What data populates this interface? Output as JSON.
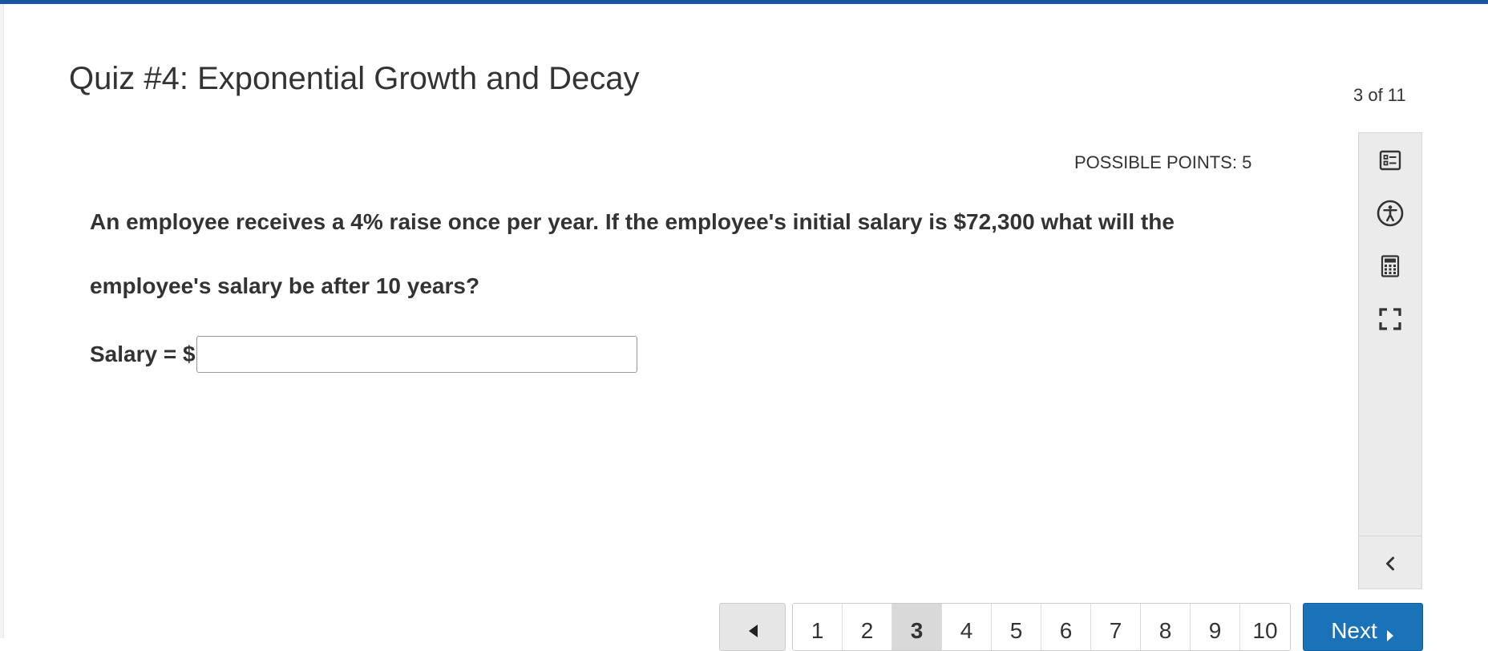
{
  "quiz": {
    "title": "Quiz #4: Exponential Growth and Decay",
    "progress": "3 of 11"
  },
  "question": {
    "points": "POSSIBLE POINTS: 5",
    "text": "An employee receives a 4% raise once per year. If the employee's initial salary is $72,300 what will the employee's salary be after 10 years?",
    "answer_label": "Salary = $",
    "answer_value": ""
  },
  "toolbar": {
    "tools": [
      {
        "icon": "question-list-icon"
      },
      {
        "icon": "accessibility-icon"
      },
      {
        "icon": "calculator-icon"
      },
      {
        "icon": "fullscreen-icon"
      }
    ],
    "collapse_icon": "chevron-left-icon"
  },
  "pagination": {
    "prev_icon": "caret-left-icon",
    "pages": [
      "1",
      "2",
      "3",
      "4",
      "5",
      "6",
      "7",
      "8",
      "9",
      "10"
    ],
    "current_page": "3",
    "next_label": "Next",
    "next_icon": "caret-right-icon"
  },
  "colors": {
    "accent": "#1a56a0",
    "next_button": "#1a73b8",
    "current_page_bg": "#d9d9d9",
    "panel_bg": "#ebebeb"
  }
}
